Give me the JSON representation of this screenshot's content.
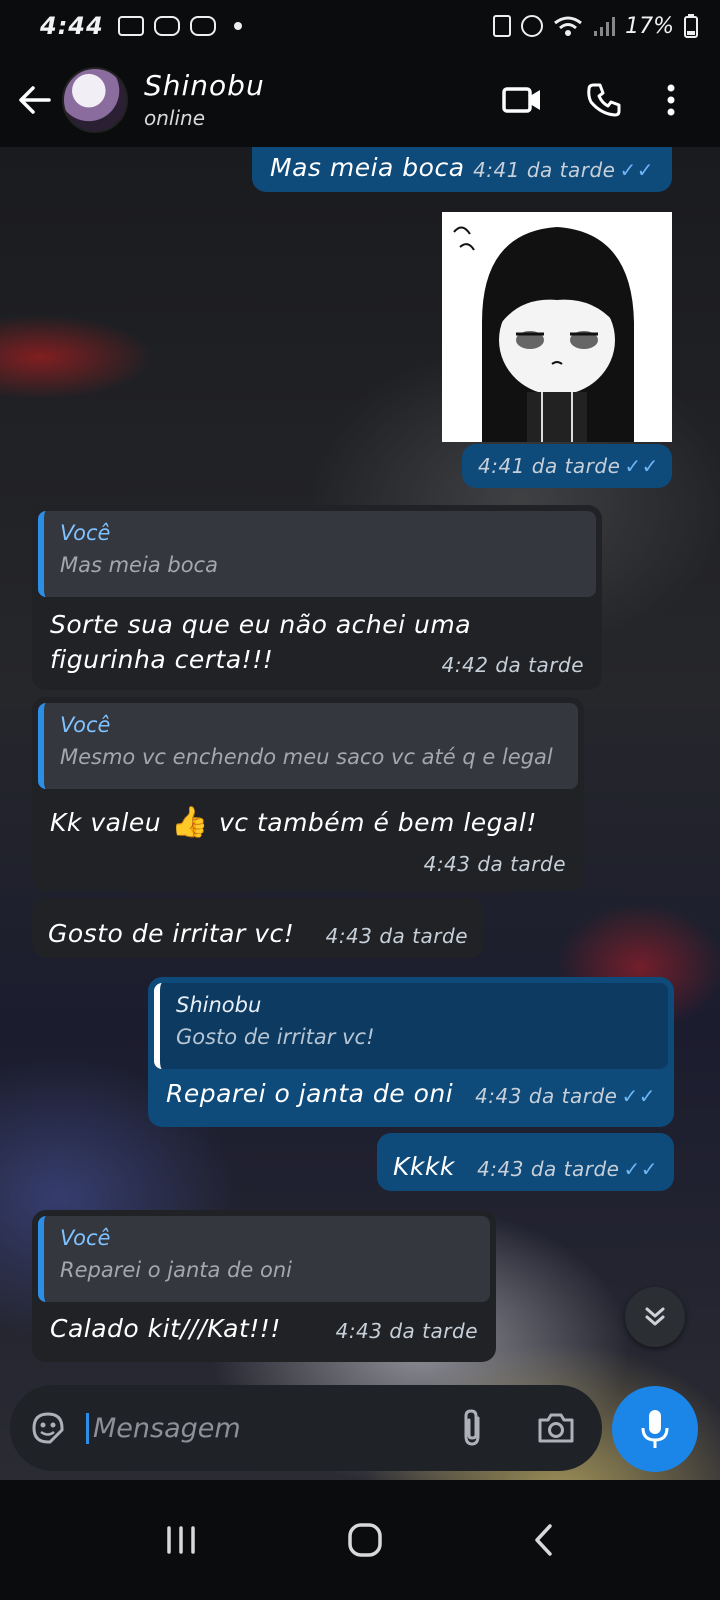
{
  "status_bar": {
    "time": "4:44",
    "battery": "17%"
  },
  "header": {
    "contact_name": "Shinobu",
    "contact_status": "online"
  },
  "messages": [
    {
      "direction": "out",
      "text": "Mas meia boca",
      "time": "4:41 da tarde"
    },
    {
      "direction": "out",
      "type": "sticker",
      "time": "4:41 da tarde"
    },
    {
      "direction": "in",
      "quote_author": "Você",
      "quote_text": "Mas meia boca",
      "text_line1": "Sorte sua que eu não achei uma",
      "text_line2": "figurinha certa!!!",
      "time": "4:42 da tarde"
    },
    {
      "direction": "in",
      "quote_author": "Você",
      "quote_text": "Mesmo vc enchendo meu saco vc até q e legal",
      "text_before_emoji": "Kk valeu",
      "emoji": "👍",
      "text_after_emoji": "vc também é bem legal!",
      "time": "4:43 da tarde"
    },
    {
      "direction": "in",
      "text": "Gosto de irritar vc!",
      "time": "4:43 da tarde"
    },
    {
      "direction": "out",
      "quote_author": "Shinobu",
      "quote_text": "Gosto de irritar vc!",
      "text": "Reparei o janta de oni",
      "time": "4:43 da tarde"
    },
    {
      "direction": "out",
      "text": "Kkkk",
      "time": "4:43 da tarde"
    },
    {
      "direction": "in",
      "quote_author": "Você",
      "quote_text": "Reparei o janta de oni",
      "text": "Calado kit///Kat!!!",
      "time": "4:43 da tarde"
    }
  ],
  "input": {
    "placeholder": "Mensagem"
  },
  "colors": {
    "outgoing_bubble": "#0e4a7a",
    "incoming_bubble": "#202226",
    "accent": "#1b86e8",
    "read_ticks": "#6cb6f5"
  },
  "icons": [
    "back-arrow-icon",
    "video-call-icon",
    "phone-icon",
    "more-vert-icon",
    "sticker-icon",
    "attach-icon",
    "camera-icon",
    "mic-icon",
    "scroll-down-icon",
    "recents-icon",
    "home-icon",
    "nav-back-icon"
  ]
}
